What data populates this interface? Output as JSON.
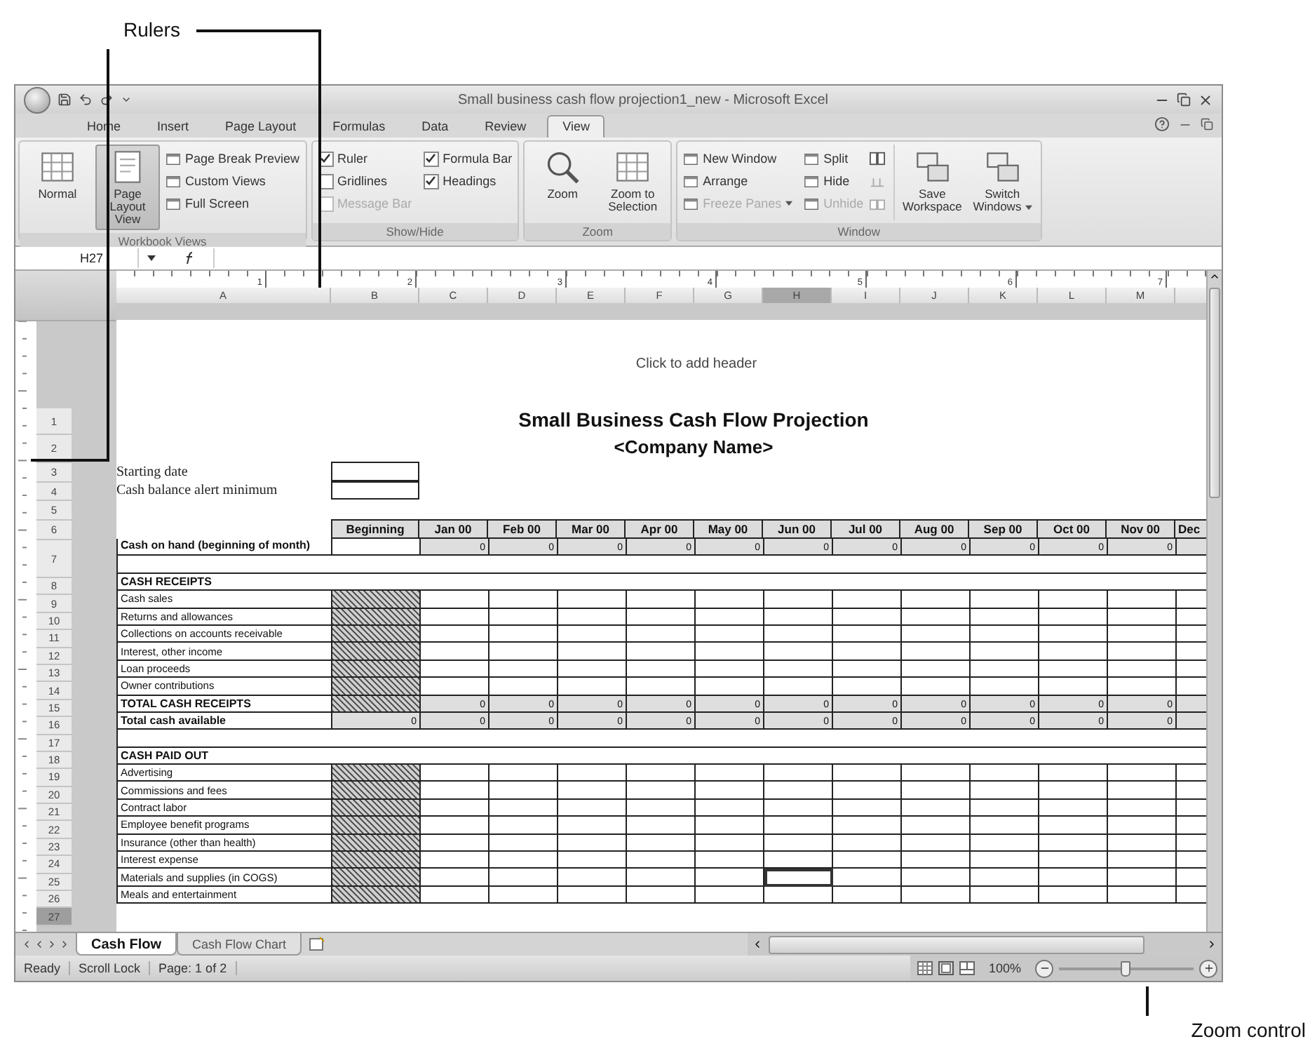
{
  "callouts": [
    {
      "label": "Rulers"
    },
    {
      "label": "Zoom control"
    }
  ],
  "window": {
    "title": "Small business cash flow projection1_new - Microsoft Excel"
  },
  "ribbon_tabs": [
    {
      "label": "Home",
      "selected": false
    },
    {
      "label": "Insert",
      "selected": false
    },
    {
      "label": "Page Layout",
      "selected": false
    },
    {
      "label": "Formulas",
      "selected": false
    },
    {
      "label": "Data",
      "selected": false
    },
    {
      "label": "Review",
      "selected": false
    },
    {
      "label": "View",
      "selected": true
    }
  ],
  "ribbon_groups": [
    {
      "kind": "views",
      "label": "Workbook Views",
      "items": [
        {
          "kind": "large",
          "label": "Normal",
          "selected": false,
          "disabled": false
        },
        {
          "kind": "large",
          "label": "Page Layout View",
          "selected": true,
          "disabled": false
        },
        {
          "kind": "small",
          "label": "Page Break Preview",
          "selected": false,
          "disabled": false
        },
        {
          "kind": "small",
          "label": "Custom Views",
          "selected": false,
          "disabled": false
        },
        {
          "kind": "small",
          "label": "Full Screen",
          "selected": false,
          "disabled": false
        }
      ]
    },
    {
      "kind": "showhide",
      "label": "Show/Hide",
      "items": [
        {
          "kind": "check",
          "label": "Ruler",
          "checked": true,
          "disabled": false
        },
        {
          "kind": "check",
          "label": "Gridlines",
          "checked": false,
          "disabled": false
        },
        {
          "kind": "check",
          "label": "Message Bar",
          "checked": false,
          "disabled": true
        },
        {
          "kind": "check",
          "label": "Formula Bar",
          "checked": true,
          "disabled": false
        },
        {
          "kind": "check",
          "label": "Headings",
          "checked": true,
          "disabled": false
        }
      ]
    },
    {
      "kind": "zoom",
      "label": "Zoom",
      "items": [
        {
          "kind": "large",
          "label": "Zoom",
          "disabled": false
        },
        {
          "kind": "large",
          "label": "Zoom to Selection",
          "disabled": false
        }
      ]
    },
    {
      "kind": "window",
      "label": "Window",
      "items": [
        {
          "kind": "small",
          "label": "New Window",
          "disabled": false
        },
        {
          "kind": "small",
          "label": "Arrange",
          "disabled": false
        },
        {
          "kind": "small",
          "label": "Freeze Panes",
          "disabled": true,
          "dropdown": true
        },
        {
          "kind": "small",
          "label": "Split",
          "disabled": false
        },
        {
          "kind": "small",
          "label": "Hide",
          "disabled": false
        },
        {
          "kind": "small",
          "label": "Unhide",
          "disabled": true
        },
        {
          "kind": "large",
          "label": "Save Workspace",
          "disabled": false
        },
        {
          "kind": "large",
          "label": "Switch Windows",
          "disabled": false,
          "dropdown": true
        }
      ]
    }
  ],
  "formula_bar": {
    "name_box": "H27"
  },
  "ruler_marks": [
    "1",
    "2",
    "3",
    "4",
    "5",
    "6",
    "7"
  ],
  "columns": [
    {
      "label": "A",
      "selected": false
    },
    {
      "label": "B",
      "selected": false
    },
    {
      "label": "C",
      "selected": false
    },
    {
      "label": "D",
      "selected": false
    },
    {
      "label": "E",
      "selected": false
    },
    {
      "label": "F",
      "selected": false
    },
    {
      "label": "G",
      "selected": false
    },
    {
      "label": "H",
      "selected": true
    },
    {
      "label": "I",
      "selected": false
    },
    {
      "label": "J",
      "selected": false
    },
    {
      "label": "K",
      "selected": false
    },
    {
      "label": "L",
      "selected": false
    },
    {
      "label": "M",
      "selected": false
    }
  ],
  "row_numbers": [
    {
      "label": "1",
      "selected": false
    },
    {
      "label": "2",
      "selected": false
    },
    {
      "label": "3",
      "selected": false
    },
    {
      "label": "4",
      "selected": false
    },
    {
      "label": "5",
      "selected": false
    },
    {
      "label": "6",
      "selected": false
    },
    {
      "label": "7",
      "selected": false
    },
    {
      "label": "8",
      "selected": false
    },
    {
      "label": "9",
      "selected": false
    },
    {
      "label": "10",
      "selected": false
    },
    {
      "label": "11",
      "selected": false
    },
    {
      "label": "12",
      "selected": false
    },
    {
      "label": "13",
      "selected": false
    },
    {
      "label": "14",
      "selected": false
    },
    {
      "label": "15",
      "selected": false
    },
    {
      "label": "16",
      "selected": false
    },
    {
      "label": "17",
      "selected": false
    },
    {
      "label": "18",
      "selected": false
    },
    {
      "label": "19",
      "selected": false
    },
    {
      "label": "20",
      "selected": false
    },
    {
      "label": "21",
      "selected": false
    },
    {
      "label": "22",
      "selected": false
    },
    {
      "label": "23",
      "selected": false
    },
    {
      "label": "24",
      "selected": false
    },
    {
      "label": "25",
      "selected": false
    },
    {
      "label": "26",
      "selected": false
    },
    {
      "label": "27",
      "selected": true
    }
  ],
  "sheet": {
    "header_hint": "Click to add header",
    "title": "Small Business Cash Flow Projection",
    "subtitle": "<Company Name>",
    "inputs": [
      {
        "label": "Starting date"
      },
      {
        "label": "Cash balance alert minimum"
      }
    ],
    "beginning_label": "Beginning",
    "months": [
      "Jan 00",
      "Feb 00",
      "Mar 00",
      "Apr 00",
      "May 00",
      "Jun 00",
      "Jul 00",
      "Aug 00",
      "Sep 00",
      "Oct 00",
      "Nov 00",
      "Dec"
    ],
    "rows": [
      {
        "kind": "balance",
        "label": "Cash on hand (beginning of month)",
        "hatched": false,
        "values": [
          "0",
          "0",
          "0",
          "0",
          "0",
          "0",
          "0",
          "0",
          "0",
          "0",
          "0"
        ]
      },
      {
        "kind": "spacer"
      },
      {
        "kind": "section",
        "label": "CASH RECEIPTS"
      },
      {
        "kind": "entry",
        "label": "Cash sales",
        "hatched": true
      },
      {
        "kind": "entry",
        "label": "Returns and allowances",
        "hatched": true
      },
      {
        "kind": "entry",
        "label": "Collections on accounts receivable",
        "hatched": true
      },
      {
        "kind": "entry",
        "label": "Interest, other income",
        "hatched": true
      },
      {
        "kind": "entry",
        "label": "Loan proceeds",
        "hatched": true
      },
      {
        "kind": "entry",
        "label": "Owner contributions",
        "hatched": true
      },
      {
        "kind": "total",
        "label": "TOTAL CASH RECEIPTS",
        "hatched": true,
        "values": [
          "0",
          "0",
          "0",
          "0",
          "0",
          "0",
          "0",
          "0",
          "0",
          "0",
          "0"
        ]
      },
      {
        "kind": "total",
        "label": "Total cash available",
        "hatched": false,
        "beginning": "0",
        "values": [
          "0",
          "0",
          "0",
          "0",
          "0",
          "0",
          "0",
          "0",
          "0",
          "0",
          "0"
        ]
      },
      {
        "kind": "spacer"
      },
      {
        "kind": "section",
        "label": "CASH PAID OUT"
      },
      {
        "kind": "entry",
        "label": "Advertising",
        "hatched": true
      },
      {
        "kind": "entry",
        "label": "Commissions and fees",
        "hatched": true
      },
      {
        "kind": "entry",
        "label": "Contract labor",
        "hatched": true
      },
      {
        "kind": "entry",
        "label": "Employee benefit programs",
        "hatched": true
      },
      {
        "kind": "entry",
        "label": "Insurance (other than health)",
        "hatched": true
      },
      {
        "kind": "entry",
        "label": "Interest expense",
        "hatched": true
      },
      {
        "kind": "entry",
        "label": "Materials and supplies (in COGS)",
        "hatched": true
      },
      {
        "kind": "entry",
        "label": "Meals and entertainment",
        "hatched": true
      }
    ]
  },
  "sheet_tabs": [
    {
      "label": "Cash Flow",
      "selected": true
    },
    {
      "label": "Cash Flow Chart",
      "selected": false
    }
  ],
  "status_bar": {
    "items": [
      "Ready",
      "Scroll Lock",
      "Page: 1 of 2"
    ],
    "zoom": "100%",
    "zoom_level": {
      "level": 0.5
    }
  }
}
